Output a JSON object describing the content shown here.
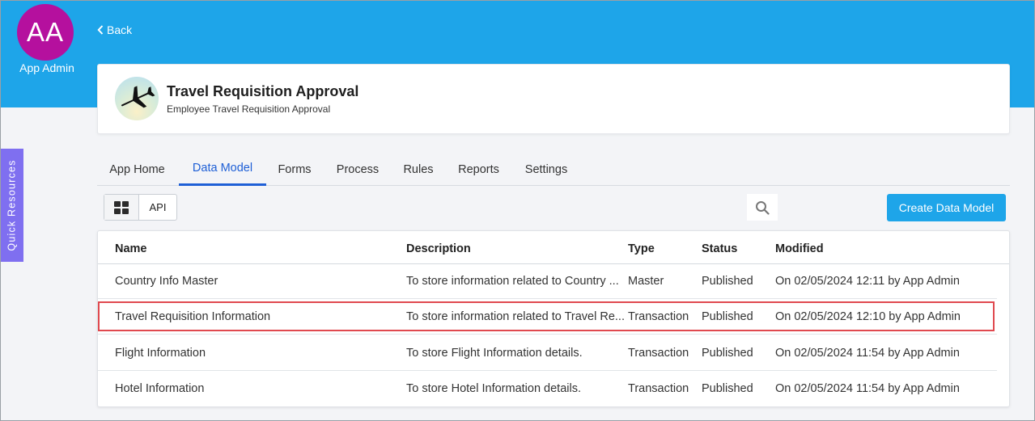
{
  "user": {
    "initials": "AA",
    "name": "App Admin"
  },
  "nav": {
    "back_label": "Back"
  },
  "quick_resources": "Quick Resources",
  "app": {
    "title": "Travel Requisition Approval",
    "subtitle": "Employee Travel Requisition Approval"
  },
  "tabs": [
    {
      "label": "App Home",
      "active": false
    },
    {
      "label": "Data Model",
      "active": true
    },
    {
      "label": "Forms",
      "active": false
    },
    {
      "label": "Process",
      "active": false
    },
    {
      "label": "Rules",
      "active": false
    },
    {
      "label": "Reports",
      "active": false
    },
    {
      "label": "Settings",
      "active": false
    }
  ],
  "toolbar": {
    "api_label": "API",
    "create_label": "Create Data Model"
  },
  "table": {
    "headers": [
      "Name",
      "Description",
      "Type",
      "Status",
      "Modified"
    ],
    "rows": [
      {
        "name": "Country Info Master",
        "description": "To store information related to Country ...",
        "type": "Master",
        "status": "Published",
        "modified": "On 02/05/2024 12:11 by App Admin"
      },
      {
        "name": "Travel Requisition Information",
        "description": "To store information related to Travel Re...",
        "type": "Transaction",
        "status": "Published",
        "modified": "On 02/05/2024 12:10 by App Admin"
      },
      {
        "name": "Flight Information",
        "description": "To store Flight Information details.",
        "type": "Transaction",
        "status": "Published",
        "modified": "On 02/05/2024 11:54 by App Admin"
      },
      {
        "name": "Hotel Information",
        "description": "To store Hotel Information details.",
        "type": "Transaction",
        "status": "Published",
        "modified": "On 02/05/2024 11:54 by App Admin"
      }
    ]
  },
  "colors": {
    "header_bg": "#1ea5e9",
    "avatar_bg": "#b5109e",
    "quick_resources_bg": "#7f6ff0",
    "active_tab": "#1e5fd6",
    "highlight": "#e0494f"
  }
}
